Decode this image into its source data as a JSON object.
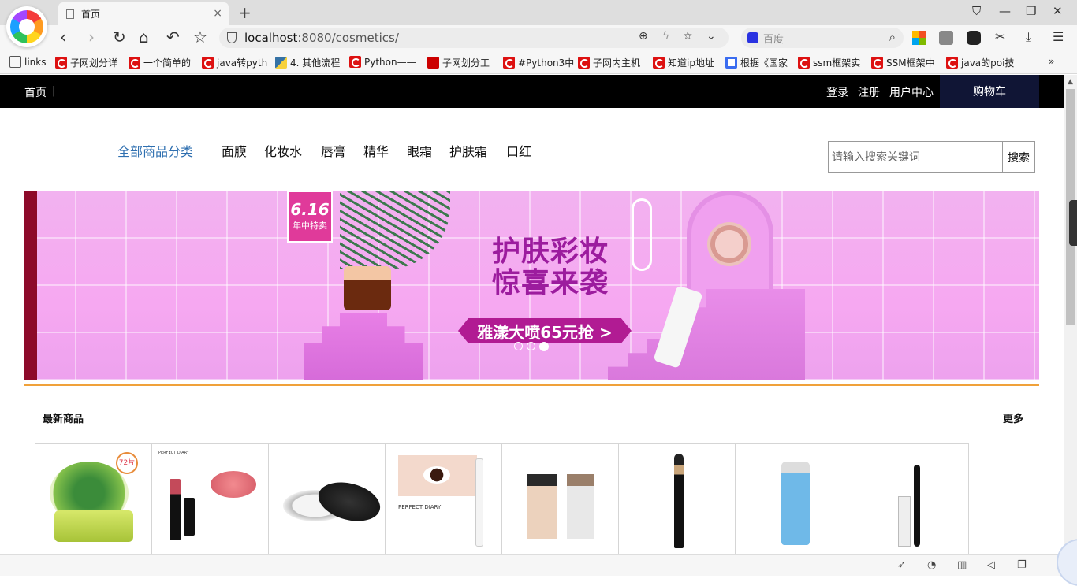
{
  "browser": {
    "tab_title": "首页",
    "tab_close": "×",
    "new_tab": "+",
    "window": {
      "pin": "⛉",
      "minimize": "—",
      "restore": "❐",
      "close": "✕"
    },
    "nav": {
      "back": "‹",
      "forward": "›",
      "reload": "↻",
      "home": "⌂",
      "undo": "↶",
      "bookmark": "☆"
    },
    "url_host": "localhost",
    "url_path": ":8080/cosmetics/",
    "url_actions": {
      "zoom": "⊕",
      "flash": "ϟ",
      "star": "☆",
      "dropdown": "⌄"
    },
    "search_placeholder": "百度",
    "search_icon": "⌕",
    "toolbar_icons": {
      "scissors": "✂",
      "download": "⤓",
      "menu": "☰"
    }
  },
  "bookmarks": [
    {
      "label": "links",
      "icon": "folder"
    },
    {
      "label": "子网划分详",
      "icon": "csdn"
    },
    {
      "label": "一个简单的",
      "icon": "csdn"
    },
    {
      "label": "java转pyth",
      "icon": "csdn"
    },
    {
      "label": "4. 其他流程",
      "icon": "python"
    },
    {
      "label": "Python——",
      "icon": "csdn"
    },
    {
      "label": "子网划分工",
      "icon": "calc"
    },
    {
      "label": "#Python3中",
      "icon": "csdn"
    },
    {
      "label": "子网内主机",
      "icon": "csdn"
    },
    {
      "label": "知道ip地址",
      "icon": "csdn"
    },
    {
      "label": "根据《国家",
      "icon": "zhihu"
    },
    {
      "label": "ssm框架实",
      "icon": "csdn"
    },
    {
      "label": "SSM框架中",
      "icon": "csdn"
    },
    {
      "label": "java的poi技",
      "icon": "csdn"
    }
  ],
  "bookmarks_more": "»",
  "site": {
    "home_link": "首页",
    "divider": "|",
    "login": "登录",
    "register": "注册",
    "user_center": "用户中心",
    "cart": "购物车",
    "all_categories": "全部商品分类",
    "categories": [
      "面膜",
      "化妆水",
      "唇膏",
      "精华",
      "眼霜",
      "护肤霜",
      "口红"
    ],
    "search_placeholder": "请输入搜索关键词",
    "search_button": "搜索",
    "banner": {
      "badge_top": "6.16",
      "badge_bottom": "年中特卖",
      "headline_1": "护肤彩妆",
      "headline_2": "惊喜来袭",
      "promo": "雅漾大喷65元抢 >",
      "slides": 3,
      "active_slide": 3
    },
    "section_title": "最新商品",
    "section_more": "更多",
    "products": [
      {
        "name": "mask-product",
        "badge": "72片"
      },
      {
        "name": "lipstick-product",
        "brand": "PERFECT DIARY"
      },
      {
        "name": "loose-powder-product"
      },
      {
        "name": "eyeliner-product",
        "text": "PERFECT DIARY"
      },
      {
        "name": "foundation-product"
      },
      {
        "name": "makeup-brush-product"
      },
      {
        "name": "makeup-remover-product"
      },
      {
        "name": "mascara-product"
      }
    ]
  },
  "colors": {
    "topnav_bg": "#000000",
    "cart_bg": "#101535",
    "category_accent": "#2e6fb0",
    "divider_orange": "#f0a13a",
    "banner_pink": "#f2b2f0",
    "banner_text": "#9c1c9e"
  }
}
